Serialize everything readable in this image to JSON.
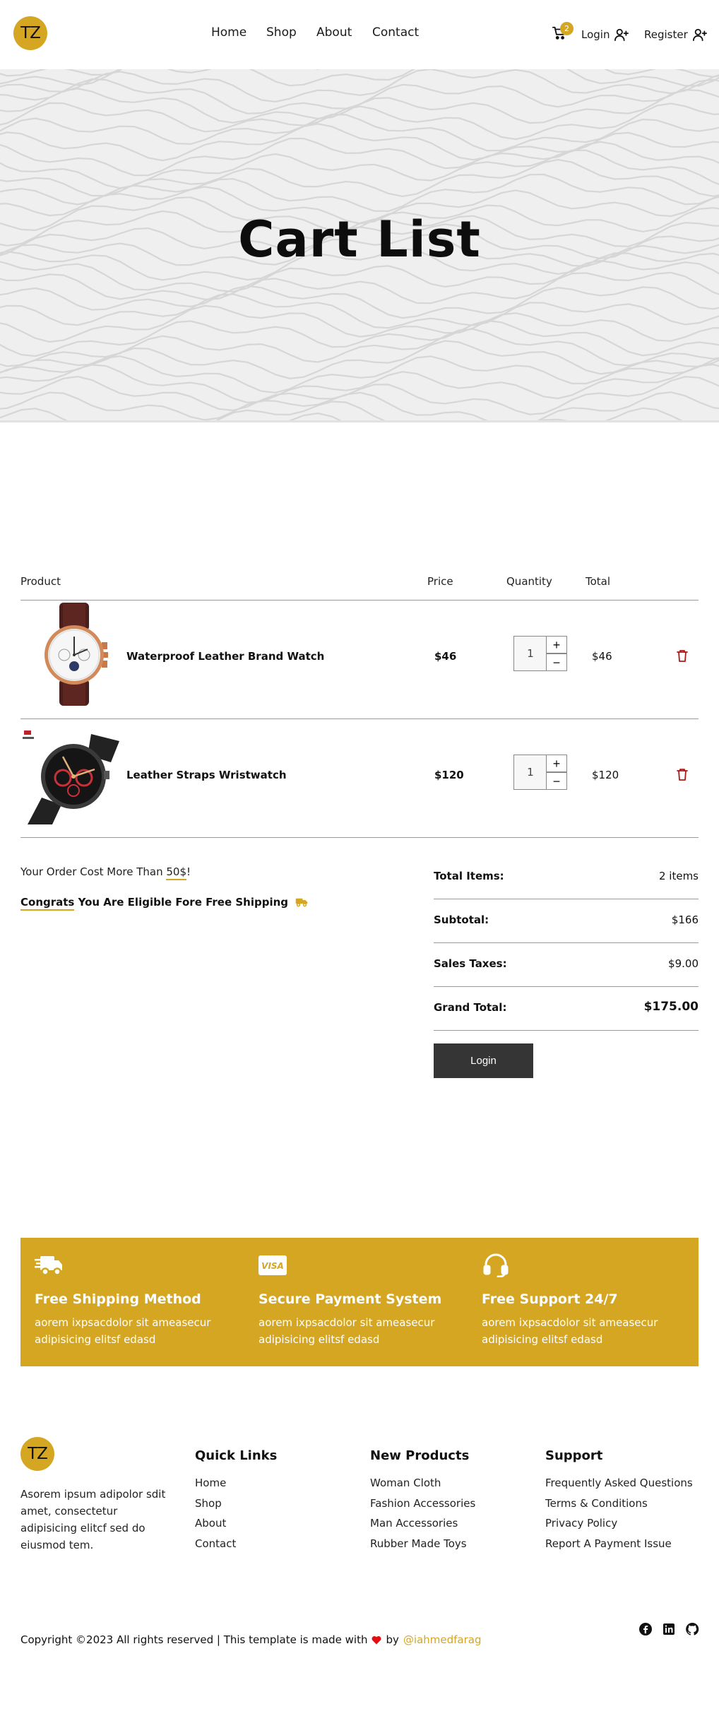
{
  "header": {
    "logo_text": "TZ",
    "nav": [
      "Home",
      "Shop",
      "About",
      "Contact"
    ],
    "cart_count": "2",
    "login_label": "Login",
    "register_label": "Register"
  },
  "hero": {
    "title": "Cart List"
  },
  "cart": {
    "columns": {
      "product": "Product",
      "price": "Price",
      "quantity": "Quantity",
      "total": "Total"
    },
    "items": [
      {
        "name": "Waterproof Leather Brand Watch",
        "price": "$46",
        "quantity": "1",
        "total": "$46"
      },
      {
        "name": "Leather Straps Wristwatch",
        "price": "$120",
        "quantity": "1",
        "total": "$120"
      }
    ],
    "qty_plus": "+",
    "qty_minus": "−"
  },
  "shipping_note": {
    "prefix": "Your Order Cost More Than ",
    "amount": "50$",
    "suffix": "!",
    "congrats_highlight": "Congrats",
    "congrats_rest": " You Are Eligible Fore Free Shipping"
  },
  "summary": {
    "total_items_label": "Total Items:",
    "total_items_value": "2 items",
    "subtotal_label": "Subtotal:",
    "subtotal_value": "$166",
    "taxes_label": "Sales Taxes:",
    "taxes_value": "$9.00",
    "grand_total_label": "Grand Total:",
    "grand_total_value": "$175.00",
    "button_label": "Login"
  },
  "features": [
    {
      "icon": "truck-icon",
      "title": "Free Shipping Method",
      "text": "aorem ixpsacdolor sit ameasecur adipisicing elitsf edasd"
    },
    {
      "icon": "visa-card-icon",
      "title": "Secure Payment System",
      "text": "aorem ixpsacdolor sit ameasecur adipisicing elitsf edasd"
    },
    {
      "icon": "headset-icon",
      "title": "Free Support 24/7",
      "text": "aorem ixpsacdolor sit ameasecur adipisicing elitsf edasd"
    }
  ],
  "footer": {
    "logo_text": "TZ",
    "about": "Asorem ipsum adipolor sdit amet, consectetur adipisicing elitcf sed do eiusmod tem.",
    "quick_links": {
      "title": "Quick Links",
      "links": [
        "Home",
        "Shop",
        "About",
        "Contact"
      ]
    },
    "new_products": {
      "title": "New Products",
      "links": [
        "Woman Cloth",
        "Fashion Accessories",
        "Man Accessories",
        "Rubber Made Toys"
      ]
    },
    "support": {
      "title": "Support",
      "links": [
        "Frequently Asked Questions",
        "Terms & Conditions",
        "Privacy Policy",
        "Report A Payment Issue"
      ]
    },
    "copyright_prefix": "Copyright ©2023 All rights reserved | This template is made with",
    "copyright_by": "by",
    "handle": "@iahmedfarag",
    "social": [
      "facebook-icon",
      "linkedin-icon",
      "github-icon"
    ]
  },
  "colors": {
    "accent": "#d4a622",
    "dark_button": "#353535",
    "delete": "#b01818",
    "heart": "#e01010"
  }
}
